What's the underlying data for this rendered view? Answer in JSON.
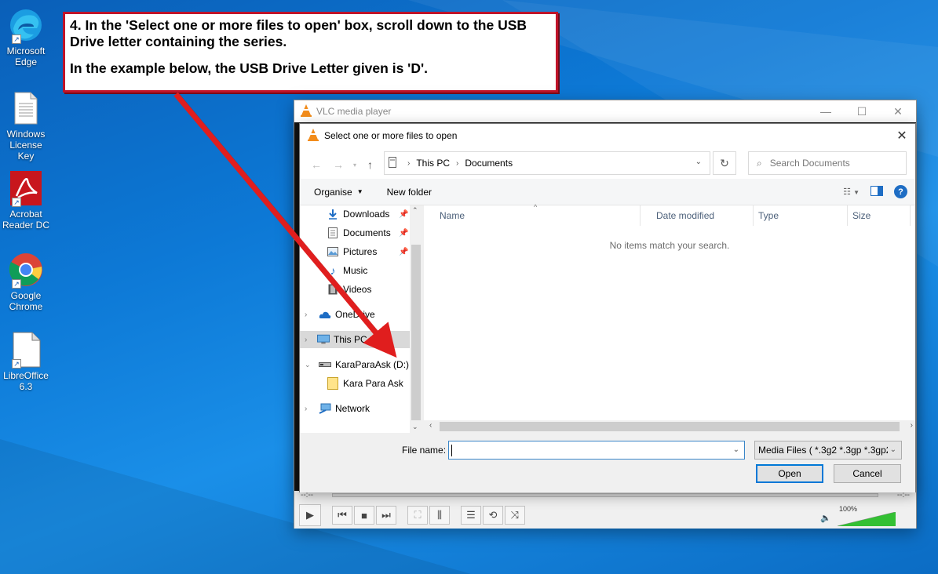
{
  "desktop": {
    "icons": [
      {
        "name": "edge-icon",
        "label": "Microsoft Edge"
      },
      {
        "name": "text-file-icon",
        "label": "Windows License Key"
      },
      {
        "name": "acrobat-icon",
        "label": "Acrobat Reader DC"
      },
      {
        "name": "chrome-icon",
        "label": "Google Chrome"
      },
      {
        "name": "libreoffice-icon",
        "label": "LibreOffice 6.3"
      }
    ]
  },
  "callout": {
    "line1": "4.  In the 'Select one or more files to open' box, scroll down to the USB Drive letter containing the series.",
    "line2": "In the example below, the USB Drive Letter given is 'D'.",
    "border_color": "#c0142a"
  },
  "vlc": {
    "title": "VLC media player",
    "time_elapsed": "--:--",
    "time_total": "--:--",
    "volume_label": "100%",
    "volume_level": 1.0
  },
  "dialog": {
    "title": "Select one or more files to open",
    "breadcrumb": [
      "This PC",
      "Documents"
    ],
    "search_placeholder": "Search Documents",
    "toolbar": {
      "organise": "Organise",
      "new_folder": "New folder"
    },
    "nav_items": [
      {
        "label": "Downloads",
        "icon": "download-arrow-icon",
        "pinned": true
      },
      {
        "label": "Documents",
        "icon": "documents-icon",
        "pinned": true
      },
      {
        "label": "Pictures",
        "icon": "pictures-icon",
        "pinned": true
      },
      {
        "label": "Music",
        "icon": "music-note-icon",
        "pinned": false
      },
      {
        "label": "Videos",
        "icon": "film-icon",
        "pinned": false
      },
      {
        "label": "OneDrive",
        "icon": "cloud-icon"
      },
      {
        "label": "This PC",
        "icon": "monitor-icon",
        "selected": true
      },
      {
        "label": "KaraParaAsk (D:)",
        "icon": "usb-drive-icon",
        "expanded": true
      },
      {
        "label": "Kara Para Ask",
        "icon": "folder-icon"
      },
      {
        "label": "Network",
        "icon": "network-icon"
      }
    ],
    "columns": [
      "Name",
      "Date modified",
      "Type",
      "Size"
    ],
    "empty_message": "No items match your search.",
    "file_name_label": "File name:",
    "file_name_value": "",
    "file_type": "Media Files ( *.3g2 *.3gp *.3gp2",
    "open_label": "Open",
    "cancel_label": "Cancel"
  },
  "colors": {
    "accent": "#0078d7",
    "arrow": "#e01e1e",
    "vlc_orange": "#f28c1b"
  }
}
